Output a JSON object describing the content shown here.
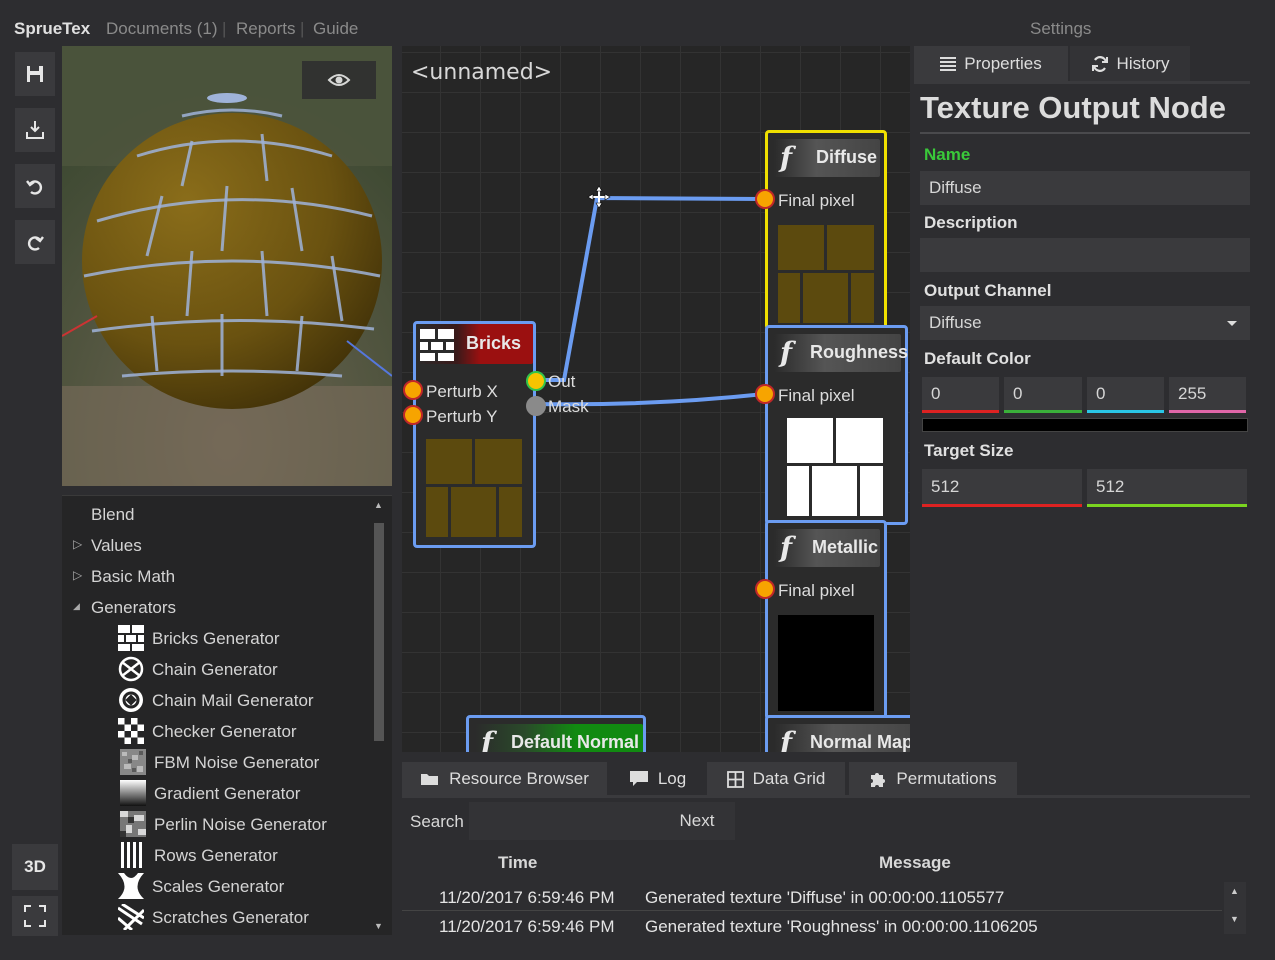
{
  "menu": {
    "brand": "SprueTex",
    "documents": "Documents (1)",
    "reports": "Reports",
    "guide": "Guide",
    "settings": "Settings"
  },
  "toolbar": {
    "save_icon": "save-icon",
    "export_icon": "export-icon",
    "undo_icon": "undo-icon",
    "redo_icon": "redo-icon",
    "mode_3d": "3D",
    "fullscreen_icon": "fullscreen-icon"
  },
  "graph": {
    "title": "<unnamed>",
    "nodes": {
      "bricks": {
        "title": "Bricks",
        "in1": "Perturb X",
        "in2": "Perturb Y",
        "out1": "Out",
        "out2": "Mask"
      },
      "diffuse": {
        "title": "Diffuse",
        "in1": "Final pixel"
      },
      "roughness": {
        "title": "Roughness",
        "in1": "Final pixel"
      },
      "metallic": {
        "title": "Metallic",
        "in1": "Final pixel"
      },
      "default_normal": {
        "title": "Default Normal"
      },
      "normal_map": {
        "title": "Normal Map"
      }
    },
    "func_glyph": "f"
  },
  "palette": {
    "categories": [
      {
        "label": "Blend",
        "arrow": ""
      },
      {
        "label": "Values",
        "arrow": "▷"
      },
      {
        "label": "Basic Math",
        "arrow": "▷"
      },
      {
        "label": "Generators",
        "arrow": "◢"
      }
    ],
    "generators": [
      "Bricks Generator",
      "Chain Generator",
      "Chain Mail Generator",
      "Checker Generator",
      "FBM Noise Generator",
      "Gradient Generator",
      "Perlin Noise Generator",
      "Rows Generator",
      "Scales Generator",
      "Scratches Generator"
    ]
  },
  "properties": {
    "tab_properties": "Properties",
    "tab_history": "History",
    "header": "Texture Output Node",
    "name_label": "Name",
    "name_value": "Diffuse",
    "description_label": "Description",
    "description_value": "",
    "channel_label": "Output Channel",
    "channel_value": "Diffuse",
    "color_label": "Default Color",
    "color": {
      "r": "0",
      "g": "0",
      "b": "0",
      "a": "255"
    },
    "size_label": "Target Size",
    "size": {
      "w": "512",
      "h": "512"
    }
  },
  "bottom": {
    "tabs": [
      "Resource Browser",
      "Log",
      "Data Grid",
      "Permutations"
    ],
    "search_label": "Search",
    "search_value": "",
    "next_label": "Next",
    "col_time": "Time",
    "col_message": "Message",
    "rows": [
      {
        "time": "11/20/2017 6:59:46 PM",
        "message": "Generated texture 'Diffuse' in 00:00:00.1105577"
      },
      {
        "time": "11/20/2017 6:59:46 PM",
        "message": "Generated texture 'Roughness' in 00:00:00.1106205"
      }
    ]
  },
  "colors": {
    "accent_green": "#3ac93a",
    "node_border": "#6b9cf1",
    "selected_border": "#f0e000",
    "bricks_header": "#9b1010",
    "normal_header": "#118a11",
    "port": "#f7a400"
  }
}
